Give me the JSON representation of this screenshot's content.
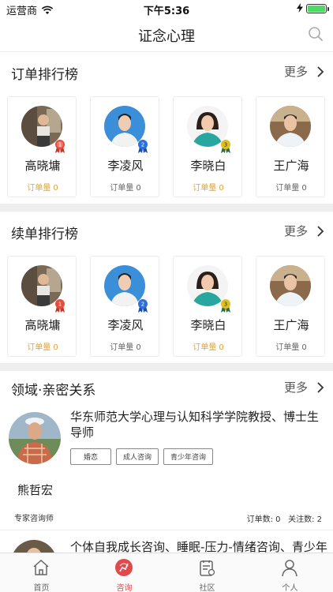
{
  "status_bar": {
    "carrier": "运营商",
    "time": "下午5:36"
  },
  "nav": {
    "title": "证念心理"
  },
  "order_ranking": {
    "title": "订单排行榜",
    "more": "更多",
    "cards": [
      {
        "name": "高晓墉",
        "orders": "订单量 0",
        "rank": "1"
      },
      {
        "name": "李凌风",
        "orders": "订单量 0",
        "rank": "2"
      },
      {
        "name": "李晓白",
        "orders": "订单量 0",
        "rank": "3"
      },
      {
        "name": "王广海",
        "orders": "订单量 0",
        "rank": ""
      }
    ]
  },
  "renewal_ranking": {
    "title": "续单排行榜",
    "more": "更多",
    "cards": [
      {
        "name": "高晓墉",
        "orders": "订单量 0",
        "rank": "1"
      },
      {
        "name": "李凌风",
        "orders": "订单量 0",
        "rank": "2"
      },
      {
        "name": "李晓白",
        "orders": "订单量 0",
        "rank": "3"
      },
      {
        "name": "王广海",
        "orders": "订单量 0",
        "rank": ""
      }
    ]
  },
  "domain_section": {
    "title": "领域·亲密关系",
    "more": "更多"
  },
  "counselors": [
    {
      "name": "熊哲宏",
      "description": "华东师范大学心理与认知科学学院教授、博士生导师",
      "tags": [
        "婚恋",
        "成人咨询",
        "青少年咨询"
      ],
      "role": "专家咨询师",
      "order_count": "订单数: 0",
      "follow_count": "关注数: 2"
    },
    {
      "description": "个体自我成长咨询、睡眠-压力-情绪咨询、青少年"
    }
  ],
  "tab_bar": {
    "tabs": [
      {
        "label": "首页",
        "icon": "home-icon"
      },
      {
        "label": "咨询",
        "icon": "consult-icon"
      },
      {
        "label": "社区",
        "icon": "community-icon"
      },
      {
        "label": "个人",
        "icon": "profile-icon"
      }
    ],
    "active_index": 1
  },
  "colors": {
    "accent": "#e14a4a",
    "gold": "#d9a441",
    "separator": "#eeeeee",
    "battery": "#4cd964"
  }
}
